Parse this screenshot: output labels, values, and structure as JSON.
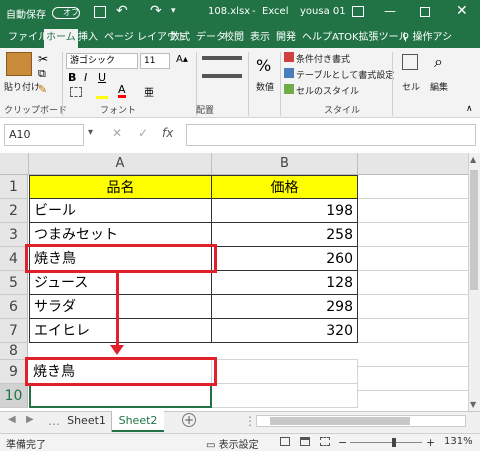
{
  "titlebar": {
    "autosave": "自動保存",
    "autosave_state": "オフ",
    "filename": "108.xlsx",
    "app": "Excel",
    "user": "yousa 01"
  },
  "tabs": [
    "ファイル",
    "ホーム",
    "挿入",
    "ページ レイアウト",
    "数式",
    "データ",
    "校閲",
    "表示",
    "開発",
    "ヘルプ",
    "ATOK拡張ツール"
  ],
  "tell_me": "操作アシ",
  "ribbon": {
    "paste": "貼り付け",
    "clipboard": "クリップボード",
    "font_name": "游ゴシック",
    "font_size": "11",
    "font_group": "フォント",
    "align_group": "配置",
    "number_group": "数値",
    "number_symbol": "%",
    "cond_format": "条件付き書式",
    "table_format": "テーブルとして書式設定",
    "cell_style": "セルのスタイル",
    "style_group": "スタイル",
    "cells": "セル",
    "editing": "編集"
  },
  "formula_bar": {
    "name_box": "A10",
    "fx": "fx",
    "formula": ""
  },
  "columns": [
    "A",
    "B"
  ],
  "rows": [
    "1",
    "2",
    "3",
    "4",
    "5",
    "6",
    "7",
    "8",
    "9",
    "10"
  ],
  "table": {
    "headers": [
      "品名",
      "価格"
    ],
    "items": [
      {
        "name": "ビール",
        "price": "198"
      },
      {
        "name": "つまみセット",
        "price": "258"
      },
      {
        "name": "焼き鳥",
        "price": "260"
      },
      {
        "name": "ジュース",
        "price": "128"
      },
      {
        "name": "サラダ",
        "price": "298"
      },
      {
        "name": "エイヒレ",
        "price": "320"
      }
    ]
  },
  "pasted_cell": "焼き鳥",
  "sheets": [
    "Sheet1",
    "Sheet2"
  ],
  "status": {
    "ready": "準備完了",
    "display_settings": "表示設定",
    "zoom": "131%"
  },
  "colors": {
    "excel_green": "#217346",
    "header_fill": "#ffff00",
    "highlight_red": "#e0202b"
  }
}
